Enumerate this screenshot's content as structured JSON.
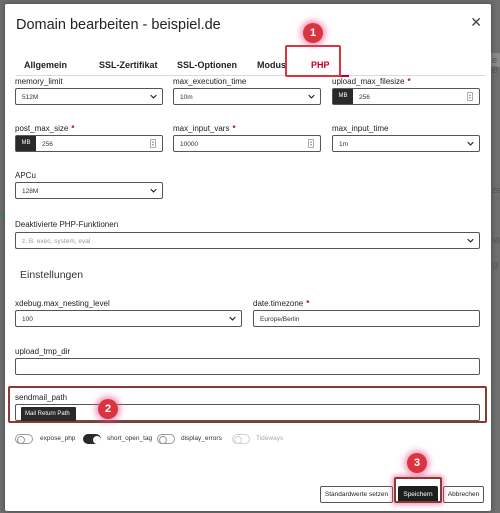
{
  "background": {
    "frag_a": "e B",
    "frag_b": "ze",
    "frag_c": "ste",
    "frag_d": "e",
    "frag_e": "g"
  },
  "dialog": {
    "title": "Domain bearbeiten - beispiel.de",
    "close_icon": "close-icon"
  },
  "tabs": [
    {
      "label": "Allgemein"
    },
    {
      "label": "SSL-Zertifikat"
    },
    {
      "label": "SSL-Optionen"
    },
    {
      "label": "Modus"
    },
    {
      "label": "PHP",
      "active": true
    }
  ],
  "fields": {
    "memory_limit": {
      "label": "memory_limit",
      "value": "512M"
    },
    "max_execution_time": {
      "label": "max_execution_time",
      "value": "10m"
    },
    "upload_max_filesize": {
      "label": "upload_max_filesize",
      "required": "*",
      "prefix": "MB",
      "value": "256"
    },
    "post_max_size": {
      "label": "post_max_size",
      "required": "*",
      "prefix": "MB",
      "value": "256"
    },
    "max_input_vars": {
      "label": "max_input_vars",
      "required": "*",
      "value": "10000"
    },
    "max_input_time": {
      "label": "max_input_time",
      "value": "1m"
    },
    "apcu": {
      "label": "APCu",
      "value": "128M"
    },
    "disabled_functions": {
      "label": "Deaktivierte PHP-Funktionen",
      "placeholder": "z. B. exec, system, eval"
    },
    "xdebug": {
      "label": "xdebug.max_nesting_level",
      "value": "100"
    },
    "timezone": {
      "label": "date.timezone",
      "required": "*",
      "value": "Europe/Berlin"
    },
    "upload_tmp_dir": {
      "label": "upload_tmp_dir",
      "value": ""
    },
    "sendmail_path": {
      "label": "sendmail_path",
      "chip": "Mail Return Path"
    }
  },
  "section_title": "Einstellungen",
  "toggles": [
    {
      "label": "expose_php",
      "on": false
    },
    {
      "label": "short_open_tag",
      "on": true
    },
    {
      "label": "display_errors",
      "on": false
    },
    {
      "label": "Tideways",
      "on": false,
      "disabled": true
    }
  ],
  "buttons": {
    "reset": "Standardwerte setzen",
    "save": "Speichern",
    "cancel": "Abbrechen"
  },
  "annotations": {
    "one": "1",
    "two": "2",
    "three": "3"
  },
  "colors": {
    "accent": "#c00020",
    "annotation": "#d9343f",
    "dark": "#1e1e1e"
  }
}
